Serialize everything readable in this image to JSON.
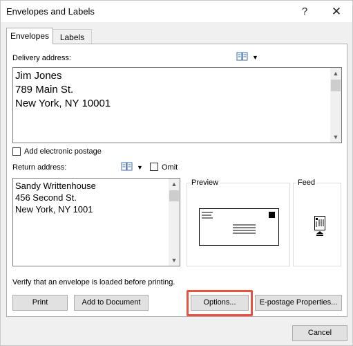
{
  "window": {
    "title": "Envelopes and Labels",
    "help_glyph": "?",
    "close_glyph": "✕"
  },
  "tabs": [
    {
      "label": "Envelopes",
      "active": true
    },
    {
      "label": "Labels",
      "active": false
    }
  ],
  "delivery": {
    "label": "Delivery address:",
    "lines": [
      "Jim Jones",
      "789 Main St.",
      "New York, NY 10001"
    ]
  },
  "electronic_postage": {
    "label": "Add electronic postage",
    "checked": false
  },
  "return_address": {
    "label": "Return address:",
    "lines": [
      "Sandy Writtenhouse",
      "456 Second St.",
      "New York, NY 1001"
    ]
  },
  "omit": {
    "label": "Omit",
    "checked": false
  },
  "preview": {
    "title": "Preview"
  },
  "feed": {
    "title": "Feed"
  },
  "notice": "Verify that an envelope is loaded before printing.",
  "buttons": {
    "print": "Print",
    "add_to_document": "Add to Document",
    "options": "Options...",
    "epostage": "E-postage Properties...",
    "cancel": "Cancel"
  },
  "icons": {
    "address_book": "address-book-icon",
    "dropdown": "▼",
    "scroll_up": "▲",
    "scroll_down": "▼"
  },
  "colors": {
    "highlight": "#e8533f",
    "panel": "#ffffff",
    "chrome": "#f0f0f0"
  }
}
